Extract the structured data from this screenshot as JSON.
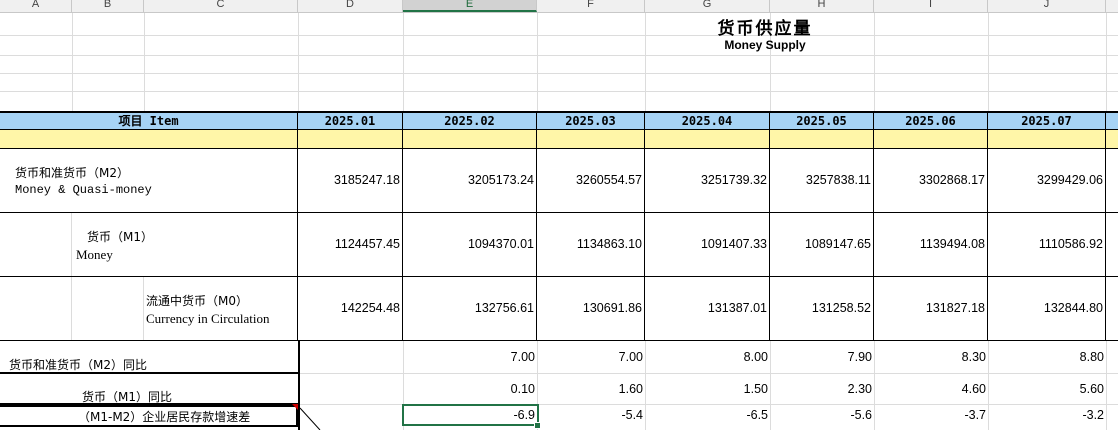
{
  "column_headers": [
    "A",
    "B",
    "C",
    "D",
    "E",
    "F",
    "G",
    "H",
    "I",
    "J"
  ],
  "title_cn": "货币供应量",
  "title_en": "Money Supply",
  "header": {
    "item_label": "项目 Item",
    "periods": [
      "2025.01",
      "2025.02",
      "2025.03",
      "2025.04",
      "2025.05",
      "2025.06",
      "2025.07"
    ]
  },
  "rows": [
    {
      "label_cn": "货币和准货币（M2）",
      "label_en": "Money & Quasi-money",
      "values": [
        "3185247.18",
        "3205173.24",
        "3260554.57",
        "3251739.32",
        "3257838.11",
        "3302868.17",
        "3299429.06"
      ]
    },
    {
      "label_cn": "货币（M1）",
      "label_en": "Money",
      "values": [
        "1124457.45",
        "1094370.01",
        "1134863.10",
        "1091407.33",
        "1089147.65",
        "1139494.08",
        "1110586.92"
      ]
    },
    {
      "label_cn": "流通中货币（M0）",
      "label_en": "Currency in Circulation",
      "values": [
        "142254.48",
        "132756.61",
        "130691.86",
        "131387.01",
        "131258.52",
        "131827.18",
        "132844.80"
      ]
    }
  ],
  "lower": [
    {
      "label": "货币和准货币（M2）同比",
      "values": [
        "7.00",
        "7.00",
        "8.00",
        "7.90",
        "8.30",
        "8.80"
      ]
    },
    {
      "label": "货币（M1）同比",
      "values": [
        "0.10",
        "1.60",
        "1.50",
        "2.30",
        "4.60",
        "5.60"
      ]
    },
    {
      "label": "（M1-M2）企业居民存款增速差",
      "values": [
        "-6.9",
        "-5.4",
        "-6.5",
        "-5.6",
        "-3.7",
        "-3.2"
      ]
    }
  ],
  "colors": {
    "header_bg": "#a6d3f5",
    "year_row_bg": "#fff6a8",
    "selection": "#217346"
  },
  "selected_cell": "E"
}
